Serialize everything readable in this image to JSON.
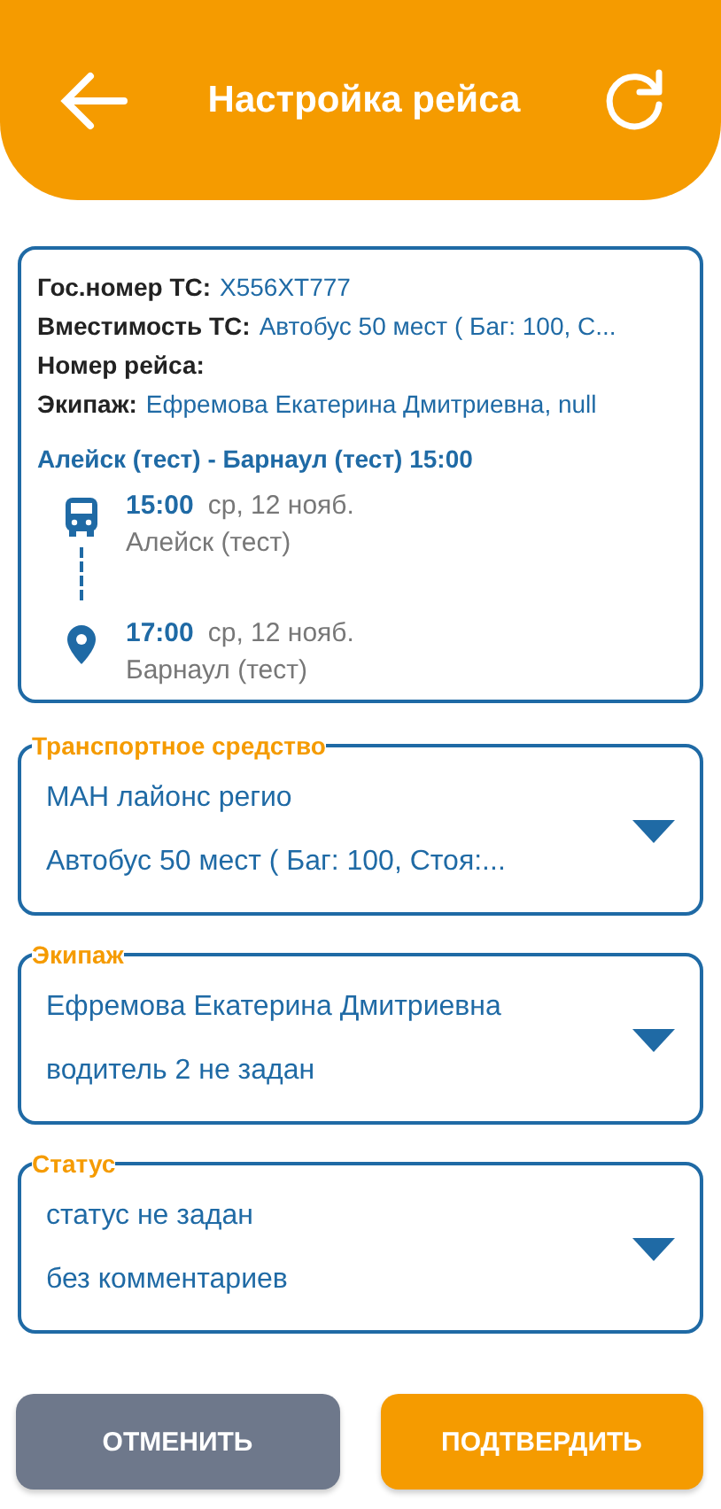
{
  "header": {
    "title": "Настройка рейса"
  },
  "trip_card": {
    "fields": [
      {
        "label": "Гос.номер ТС:",
        "value": "X556XT777"
      },
      {
        "label": "Вместимость ТС:",
        "value": "Автобус 50 мест ( Баг: 100, С..."
      },
      {
        "label": "Номер рейса:"
      },
      {
        "label": "Экипаж:",
        "value": "Ефремова Екатерина Дмитриевна, null"
      }
    ],
    "route": "Алейск (тест) - Барнаул (тест) 15:00",
    "stops": [
      {
        "kind": "departure",
        "time": "15:00",
        "date": "ср, 12 нояб.",
        "place": "Алейск (тест)"
      },
      {
        "kind": "arrival",
        "time": "17:00",
        "date": "ср, 12 нояб.",
        "place": "Барнаул (тест)"
      }
    ]
  },
  "selects": [
    {
      "label": "Транспортное средство",
      "line_1": "МАН лайонс регио",
      "line_2": "Автобус 50 мест ( Баг: 100, Стоя:..."
    },
    {
      "label": "Экипаж",
      "line_1": "Ефремова Екатерина Дмитриевна",
      "line_2": "водитель 2 не задан"
    },
    {
      "label": "Статус",
      "line_1": "статус не задан",
      "line_2": "без комментариев"
    }
  ],
  "buttons": [
    {
      "kind": "cancel",
      "label": "ОТМЕНИТЬ"
    },
    {
      "kind": "confirm",
      "label": "ПОДТВЕРДИТЬ"
    }
  ]
}
